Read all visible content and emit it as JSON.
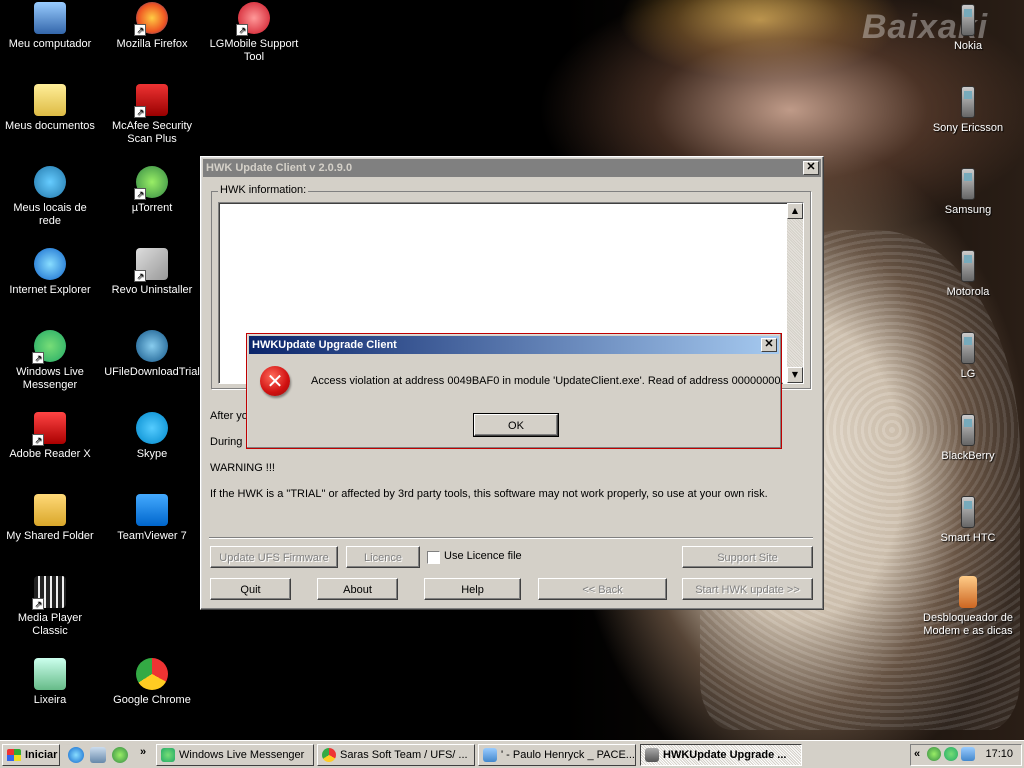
{
  "watermark": "Baixaki",
  "desktop_icons_left": [
    {
      "label": "Meu computador",
      "icon": "computer-icon"
    },
    {
      "label": "Meus documentos",
      "icon": "documents-folder-icon"
    },
    {
      "label": "Meus locais de rede",
      "icon": "network-icon"
    },
    {
      "label": "Internet Explorer",
      "icon": "ie-icon"
    },
    {
      "label": "Windows Live Messenger",
      "icon": "messenger-icon"
    },
    {
      "label": "Adobe Reader X",
      "icon": "adobe-reader-icon"
    },
    {
      "label": "My Shared Folder",
      "icon": "folder-icon"
    },
    {
      "label": "Media Player Classic",
      "icon": "media-player-icon"
    },
    {
      "label": "Lixeira",
      "icon": "recycle-bin-icon"
    }
  ],
  "desktop_icons_mid": [
    {
      "label": "Mozilla Firefox",
      "icon": "firefox-icon"
    },
    {
      "label": "McAfee Security Scan Plus",
      "icon": "mcafee-icon"
    },
    {
      "label": "µTorrent",
      "icon": "utorrent-icon"
    },
    {
      "label": "Revo Uninstaller",
      "icon": "revo-uninstaller-icon"
    },
    {
      "label": "UFileDownloadTrial",
      "icon": "globe-icon"
    },
    {
      "label": "Skype",
      "icon": "skype-icon"
    },
    {
      "label": "TeamViewer 7",
      "icon": "teamviewer-icon"
    },
    {
      "label": "Google Chrome",
      "icon": "chrome-icon"
    }
  ],
  "desktop_icon_lg": {
    "label": "LGMobile Support Tool",
    "icon": "lg-icon"
  },
  "desktop_icons_right": [
    {
      "label": "Nokia",
      "icon": "phone-icon"
    },
    {
      "label": "Sony Ericsson",
      "icon": "phone-icon"
    },
    {
      "label": "Samsung",
      "icon": "phone-icon"
    },
    {
      "label": "Motorola",
      "icon": "phone-icon"
    },
    {
      "label": "LG",
      "icon": "phone-icon"
    },
    {
      "label": "BlackBerry",
      "icon": "phone-icon"
    },
    {
      "label": "Smart HTC",
      "icon": "phone-icon"
    },
    {
      "label": "Desbloqueador de Modem e as dicas",
      "icon": "modem-phone-icon"
    }
  ],
  "main_window": {
    "title": "HWK Update Client  v 2.0.9.0",
    "group_label": "HWK information:",
    "text_after": "After yo",
    "text_during": "During I",
    "warning": "WARNING !!!",
    "trial_text": "If the HWK is a \"TRIAL\" or affected by 3rd party tools, this software may not work properly, so use at your own risk.",
    "buttons": {
      "update_ufs": "Update UFS Firmware",
      "licence": "Licence",
      "use_licence_file": "Use Licence file",
      "support_site": "Support Site",
      "quit": "Quit",
      "about": "About",
      "help": "Help",
      "back": "<< Back",
      "start": "Start HWK update >>"
    }
  },
  "error_dialog": {
    "title": "HWKUpdate Upgrade Client",
    "message": "Access violation at address 0049BAF0 in module 'UpdateClient.exe'. Read of address 00000000.",
    "ok": "OK"
  },
  "taskbar": {
    "start": "Iniciar",
    "tasks": [
      {
        "label": "Windows Live Messenger",
        "icon": "messenger-icon"
      },
      {
        "label": "Saras Soft Team / UFS/ ...",
        "icon": "chrome-icon"
      },
      {
        "label": "' - Paulo Henryck _ PACE...",
        "icon": "chat-icon"
      },
      {
        "label": "HWKUpdate Upgrade ...",
        "icon": "app-icon"
      }
    ],
    "overflow": "»",
    "tray_overflow": "«",
    "clock": "17:10"
  },
  "colors": {
    "titlebar_active_start": "#0a246a",
    "titlebar_active_end": "#a6caf0",
    "titlebar_inactive": "#808080",
    "error_border": "#c00000",
    "window_bg": "#d4d0c8"
  }
}
